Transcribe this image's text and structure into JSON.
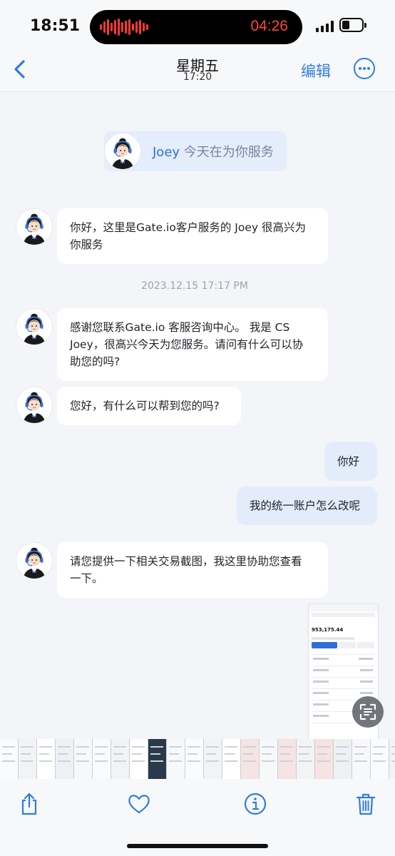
{
  "status_bar": {
    "time": "18:51",
    "recording_time": "04:26"
  },
  "nav": {
    "title": "星期五",
    "subtitle": "17:20",
    "edit_label": "编辑"
  },
  "agent_banner": {
    "name": "Joey",
    "text": "今天在为你服务"
  },
  "messages": [
    {
      "side": "left",
      "lines": [
        "你好，这里是Gate.io客户服务的 Joey 很高兴为",
        "你服务"
      ]
    },
    {
      "side": "left",
      "lines": [
        "感谢您联系Gate.io 客服咨询中心。 我是 CS",
        "Joey，很高兴今天为您服务。请问有什么可以协",
        "助您的吗?"
      ]
    },
    {
      "side": "left",
      "lines": [
        "您好，有什么可以帮到您的吗?"
      ]
    },
    {
      "side": "right",
      "lines": [
        "你好"
      ]
    },
    {
      "side": "right",
      "lines": [
        "我的统一账户怎么改呢"
      ]
    },
    {
      "side": "left",
      "lines": [
        "请您提供一下相关交易截图，我这里协助您查看",
        "一下。"
      ]
    }
  ],
  "timestamp": "2023.12.15 17:17 PM",
  "screenshot_preview": {
    "balance": "953,175.44"
  },
  "icons": {
    "back": "chevron-left-icon",
    "more": "ellipsis-circle-icon",
    "share": "share-icon",
    "favorite": "heart-icon",
    "info": "info-icon",
    "delete": "trash-icon",
    "scan": "live-text-icon"
  },
  "colors": {
    "accent": "#2f7de1",
    "recording": "#ff453a",
    "bubble_right": "#e3ecfb"
  }
}
